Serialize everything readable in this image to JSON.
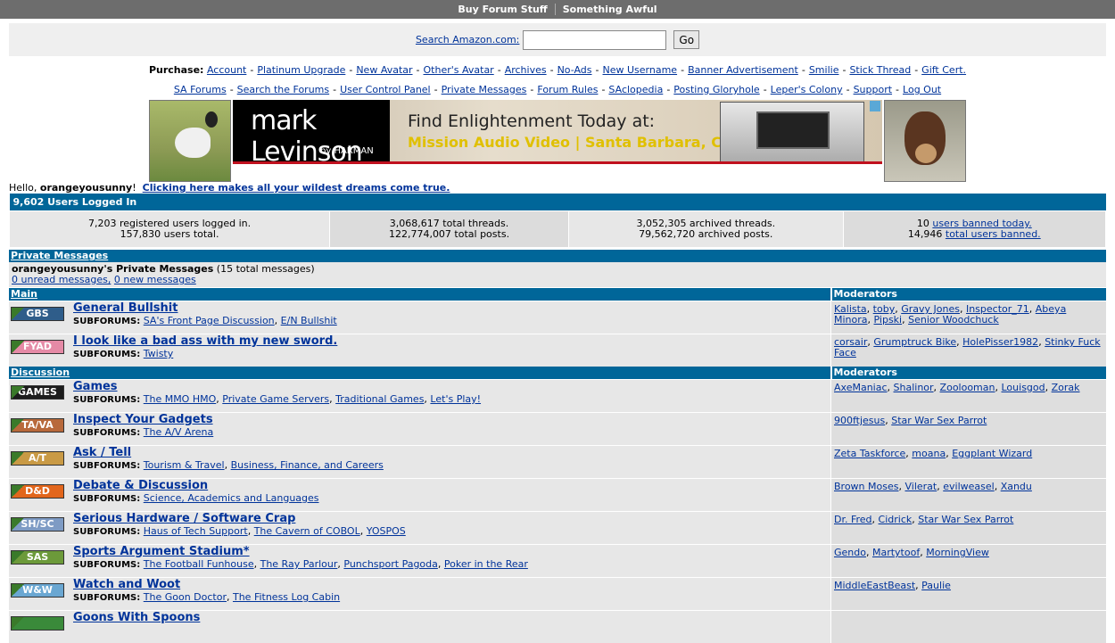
{
  "topbar": {
    "left": "Buy Forum Stuff",
    "right": "Something Awful"
  },
  "search": {
    "label": "Search Amazon.com:",
    "placeholder": "",
    "button": "Go"
  },
  "purchase": {
    "label": "Purchase:",
    "links": [
      "Account",
      "Platinum Upgrade",
      "New Avatar",
      "Other's Avatar",
      "Archives",
      "No-Ads",
      "New Username",
      "Banner Advertisement",
      "Smilie",
      "Stick Thread",
      "Gift Cert."
    ]
  },
  "nav": {
    "links": [
      "SA Forums",
      "Search the Forums",
      "User Control Panel",
      "Private Messages",
      "Forum Rules",
      "SAclopedia",
      "Posting Gloryhole",
      "Leper's Colony",
      "Support",
      "Log Out"
    ]
  },
  "ad": {
    "brand": "mark Levinson",
    "by": "by HARMAN",
    "headline": "Find Enlightenment Today at:",
    "subline": "Mission Audio Video | Santa Barbara, CA"
  },
  "hello": {
    "greeting": "Hello,",
    "user": "orangeyousunny",
    "bang": "!",
    "link": "Clicking here makes all your wildest dreams come true."
  },
  "stats": {
    "header": "9,602 Users Logged In",
    "cells": [
      {
        "l1": "7,203 registered users logged in.",
        "l2": "157,830 users total."
      },
      {
        "l1": "3,068,617 total threads.",
        "l2": "122,774,007 total posts."
      },
      {
        "l1": "3,052,305 archived threads.",
        "l2": "79,562,720 archived posts."
      }
    ],
    "banned": {
      "n1": "10",
      "l1": "users banned today.",
      "n2": "14,946",
      "l2": "total users banned."
    }
  },
  "pm": {
    "header": "Private Messages",
    "owner": "orangeyousunny's Private Messages",
    "count": "(15 total messages)",
    "unread": "0 unread messages,",
    "newmsg": "0 new messages"
  },
  "sections": [
    {
      "name": "Main",
      "mods_label": "Moderators",
      "forums": [
        {
          "tag": "GBS",
          "color": "#2f5d8a",
          "title": "General Bullshit",
          "subforums": [
            "SA's Front Page Discussion",
            "E/N Bullshit"
          ],
          "mods": [
            "Kalista",
            "toby",
            "Gravy Jones",
            "Inspector_71",
            "Abeya Minora",
            "Pipski",
            "Senior Woodchuck"
          ]
        },
        {
          "tag": "FYAD",
          "color": "#e58aa6",
          "title": "I look like a bad ass with my new sword.",
          "subforums": [
            "Twisty"
          ],
          "mods": [
            "corsair",
            "Grumptruck Bike",
            "HolePisser1982",
            "Stinky Fuck Face"
          ]
        }
      ]
    },
    {
      "name": "Discussion",
      "mods_label": "Moderators",
      "forums": [
        {
          "tag": "GAMES",
          "color": "#1c1c1c",
          "title": "Games",
          "subforums": [
            "The MMO HMO",
            "Private Game Servers",
            "Traditional Games",
            "Let's Play!"
          ],
          "mods": [
            "AxeManiac",
            "Shalinor",
            "Zoolooman",
            "Louisgod",
            "Zorak"
          ]
        },
        {
          "tag": "TA/VA",
          "color": "#b8693b",
          "title": "Inspect Your Gadgets",
          "subforums": [
            "The A/V Arena"
          ],
          "mods": [
            "900ftjesus",
            "Star War Sex Parrot"
          ]
        },
        {
          "tag": "A/T",
          "color": "#c99a45",
          "title": "Ask / Tell",
          "subforums": [
            "Tourism & Travel",
            "Business, Finance, and Careers"
          ],
          "mods": [
            "Zeta Taskforce",
            "moana",
            "Eggplant Wizard"
          ]
        },
        {
          "tag": "D&D",
          "color": "#e2661c",
          "title": "Debate & Discussion",
          "subforums": [
            "Science, Academics and Languages"
          ],
          "mods": [
            "Brown Moses",
            "Vilerat",
            "evilweasel",
            "Xandu"
          ]
        },
        {
          "tag": "SH/SC",
          "color": "#7e9bc4",
          "title": "Serious Hardware / Software Crap",
          "subforums": [
            "Haus of Tech Support",
            "The Cavern of COBOL",
            "YOSPOS"
          ],
          "mods": [
            "Dr. Fred",
            "Cidrick",
            "Star War Sex Parrot"
          ]
        },
        {
          "tag": "SAS",
          "color": "#6c9a3a",
          "title": "Sports Argument Stadium*",
          "subforums": [
            "The Football Funhouse",
            "The Ray Parlour",
            "Punchsport Pagoda",
            "Poker in the Rear"
          ],
          "mods": [
            "Gendo",
            "Martytoof",
            "MorningView"
          ]
        },
        {
          "tag": "W&W",
          "color": "#6aa7d2",
          "title": "Watch and Woot",
          "subforums": [
            "The Goon Doctor",
            "The Fitness Log Cabin"
          ],
          "mods": [
            "MiddleEastBeast",
            "Paulie"
          ]
        },
        {
          "tag": "",
          "color": "#3a8a3a",
          "title": "Goons With Spoons",
          "subforums": [],
          "mods": []
        }
      ]
    }
  ],
  "subforums_label": "SUBFORUMS:"
}
